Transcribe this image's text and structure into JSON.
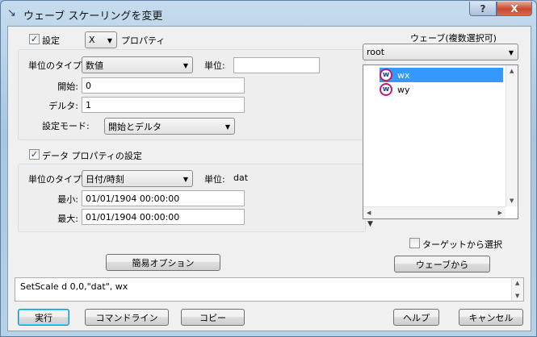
{
  "window": {
    "title": "ウェーブ スケーリングを変更",
    "help_label": "?",
    "close_label": "X"
  },
  "setting": {
    "checkbox_checked": true,
    "checkbox_label": "設定",
    "axis_value": "X",
    "property_label": "プロパティ",
    "unit_type_label": "単位のタイプ:",
    "unit_type_value": "数値",
    "unit_label": "単位:",
    "unit_value": "",
    "start_label": "開始:",
    "start_value": "0",
    "delta_label": "デルタ:",
    "delta_value": "1",
    "mode_label": "設定モード:",
    "mode_value": "開始とデルタ"
  },
  "data_props": {
    "checkbox_checked": true,
    "checkbox_label": "データ プロパティの設定",
    "unit_type_label": "単位のタイプ:",
    "unit_type_value": "日付/時刻",
    "unit_label": "単位:",
    "unit_value": "dat",
    "min_label": "最小:",
    "min_value": "01/01/1904 00:00:00",
    "max_label": "最大:",
    "max_value": "01/01/1904 00:00:00"
  },
  "waves": {
    "header": "ウェーブ(複数選択可)",
    "folder_value": "root",
    "items": [
      {
        "name": "wx",
        "selected": true
      },
      {
        "name": "wy",
        "selected": false
      }
    ],
    "target_checkbox_label": "ターゲットから選択",
    "from_wave_button": "ウェーブから"
  },
  "simple_options_button": "簡易オプション",
  "command": "SetScale d 0,0,\"dat\", wx",
  "buttons": {
    "execute": "実行",
    "command_line": "コマンドライン",
    "copy": "コピー",
    "help": "ヘルプ",
    "cancel": "キャンセル"
  },
  "icons": {
    "window_icon": "scale-arrow-icon",
    "wave_icon": "wave-icon",
    "dropdown_arrow": "chevron-down-icon"
  }
}
